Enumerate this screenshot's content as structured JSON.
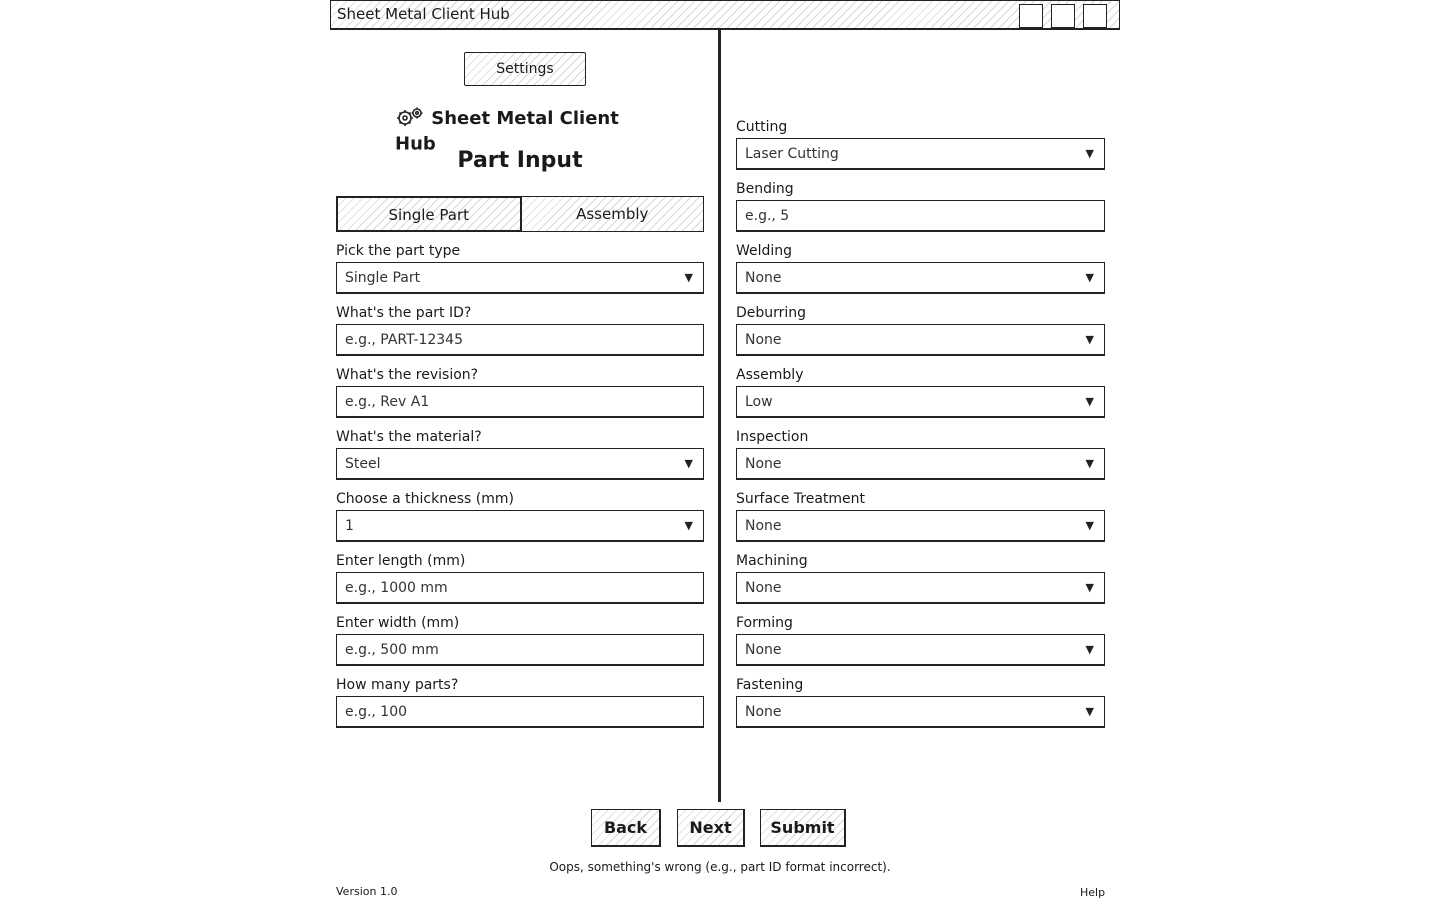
{
  "window": {
    "title": "Sheet Metal Client Hub"
  },
  "header": {
    "settings_label": "Settings",
    "app_name": "Sheet Metal Client Hub",
    "section_title": "Part Input"
  },
  "part_mode": {
    "options": [
      "Single Part",
      "Assembly"
    ],
    "active": "Single Part"
  },
  "left_fields": [
    {
      "label": "Pick the part type",
      "kind": "select",
      "value": "Single Part"
    },
    {
      "label": "What's the part ID?",
      "kind": "input",
      "placeholder": "e.g., PART-12345"
    },
    {
      "label": "What's the revision?",
      "kind": "input",
      "placeholder": "e.g., Rev A1"
    },
    {
      "label": "What's the material?",
      "kind": "select",
      "value": "Steel"
    },
    {
      "label": "Choose a thickness (mm)",
      "kind": "select",
      "value": "1"
    },
    {
      "label": "Enter length (mm)",
      "kind": "input",
      "placeholder": "e.g., 1000 mm"
    },
    {
      "label": "Enter width (mm)",
      "kind": "input",
      "placeholder": "e.g., 500 mm"
    },
    {
      "label": "How many parts?",
      "kind": "input",
      "placeholder": "e.g., 100"
    }
  ],
  "right_fields": [
    {
      "label": "Cutting",
      "kind": "select",
      "value": "Laser Cutting"
    },
    {
      "label": "Bending",
      "kind": "input",
      "placeholder": "e.g., 5"
    },
    {
      "label": "Welding",
      "kind": "select",
      "value": "None"
    },
    {
      "label": "Deburring",
      "kind": "select",
      "value": "None"
    },
    {
      "label": "Assembly",
      "kind": "select",
      "value": "Low"
    },
    {
      "label": "Inspection",
      "kind": "select",
      "value": "None"
    },
    {
      "label": "Surface Treatment",
      "kind": "select",
      "value": "None"
    },
    {
      "label": "Machining",
      "kind": "select",
      "value": "None"
    },
    {
      "label": "Forming",
      "kind": "select",
      "value": "None"
    },
    {
      "label": "Fastening",
      "kind": "select",
      "value": "None"
    }
  ],
  "actions": {
    "back": "Back",
    "next": "Next",
    "submit": "Submit"
  },
  "footer": {
    "error": "Oops, something's wrong (e.g., part ID format incorrect).",
    "version": "Version 1.0",
    "help": "Help"
  },
  "icons": {
    "app": "gears-icon",
    "select": "chevron-down-icon"
  }
}
